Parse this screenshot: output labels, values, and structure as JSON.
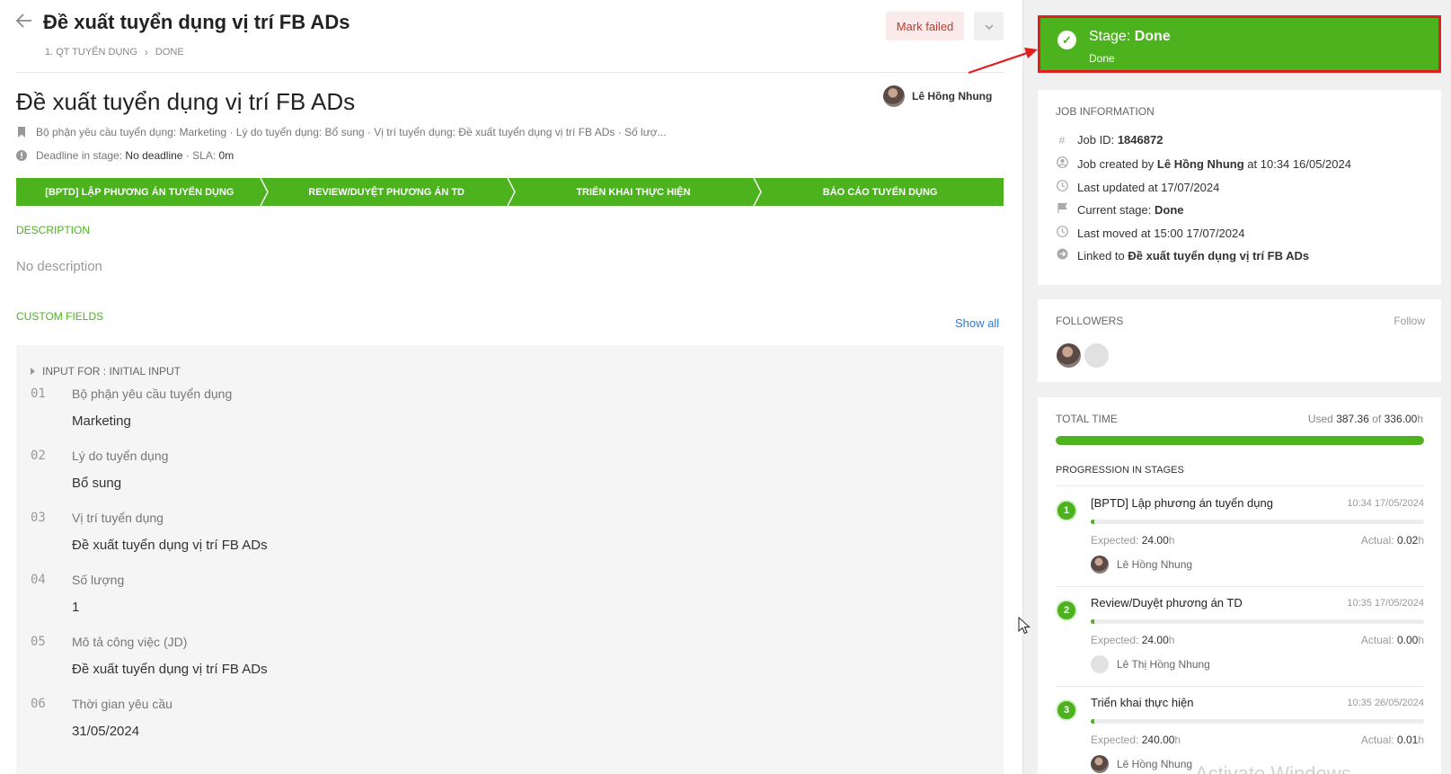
{
  "header": {
    "title": "Đề xuất tuyển dụng vị trí FB ADs",
    "breadcrumb": [
      "1. QT TUYỂN DỤNG",
      "DONE"
    ],
    "mark_failed": "Mark failed"
  },
  "job": {
    "title": "Đề xuất tuyển dụng vị trí FB ADs",
    "owner": "Lê Hồng Nhung",
    "summary": "Bộ phận yêu cầu tuyển dụng: Marketing · Lý do tuyển dụng: Bổ sung · Vị trí tuyển dụng: Đề xuất tuyển dụng vị trí FB ADs · Số lượ...",
    "deadline_label": "Deadline in stage:",
    "deadline_value": "No deadline",
    "sla_label": "· SLA:",
    "sla_value": "0m"
  },
  "stages": [
    {
      "label": "[BPTD] Lập phương án tuyển dụng"
    },
    {
      "label": "Review/Duyệt phương án TD"
    },
    {
      "label": "Triển khai thực hiện"
    },
    {
      "label": "Báo cáo tuyển dụng"
    }
  ],
  "description": {
    "label": "DESCRIPTION",
    "text": "No description"
  },
  "custom_fields": {
    "label": "CUSTOM FIELDS",
    "show_all": "Show all",
    "group": "INPUT FOR : INITIAL INPUT",
    "items": [
      {
        "num": "01",
        "label": "Bộ phận yêu cầu tuyển dụng",
        "value": "Marketing"
      },
      {
        "num": "02",
        "label": "Lý do tuyển dụng",
        "value": "Bổ sung"
      },
      {
        "num": "03",
        "label": "Vị trí tuyển dụng",
        "value": "Đề xuất tuyển dụng vị trí FB ADs"
      },
      {
        "num": "04",
        "label": "Số lượng",
        "value": "1"
      },
      {
        "num": "05",
        "label": "Mô tả công việc (JD)",
        "value": "Đề xuất tuyển dụng vị trí FB ADs"
      },
      {
        "num": "06",
        "label": "Thời gian yêu cầu",
        "value": "31/05/2024"
      }
    ]
  },
  "stage_card": {
    "prefix": "Stage:",
    "stage": "Done",
    "sub": "Done",
    "color": "#4cb31e",
    "highlight": "#e02020"
  },
  "job_info": {
    "title": "JOB INFORMATION",
    "job_id_label": "Job ID:",
    "job_id": "1846872",
    "created_prefix": "Job created by",
    "created_by": "Lê Hồng Nhung",
    "created_at": "at 10:34 16/05/2024",
    "last_updated": "Last updated at 17/07/2024",
    "current_stage_label": "Current stage:",
    "current_stage": "Done",
    "last_moved": "Last moved at 15:00 17/07/2024",
    "linked_label": "Linked to",
    "linked_to": "Đề xuất tuyển dụng vị trí FB ADs"
  },
  "followers": {
    "title": "FOLLOWERS",
    "follow": "Follow"
  },
  "total_time": {
    "title": "TOTAL TIME",
    "used_label": "Used",
    "used": "387.36",
    "of_label": "of",
    "total": "336.00",
    "unit": "h",
    "fill_fraction": 1.0,
    "progression_title": "PROGRESSION IN STAGES",
    "stages": [
      {
        "num": "1",
        "name": "[BPTD] Lập phương án tuyển dụng",
        "time": "10:34 17/05/2024",
        "expected": "24.00",
        "actual": "0.02",
        "assignee": "Lê Hồng Nhung",
        "progress": 0.01,
        "avatar": "photo"
      },
      {
        "num": "2",
        "name": "Review/Duyệt phương án TD",
        "time": "10:35 17/05/2024",
        "expected": "24.00",
        "actual": "0.00",
        "assignee": "Lê Thị Hồng Nhung",
        "progress": 0.01,
        "avatar": "ghost"
      },
      {
        "num": "3",
        "name": "Triển khai thực hiện",
        "time": "10:35 26/05/2024",
        "expected": "240.00",
        "actual": "0.01",
        "assignee": "Lê Hồng Nhung",
        "progress": 0.01,
        "avatar": "photo"
      }
    ],
    "expected_label": "Expected:",
    "actual_label": "Actual:"
  },
  "watermark": "Activate Windows"
}
